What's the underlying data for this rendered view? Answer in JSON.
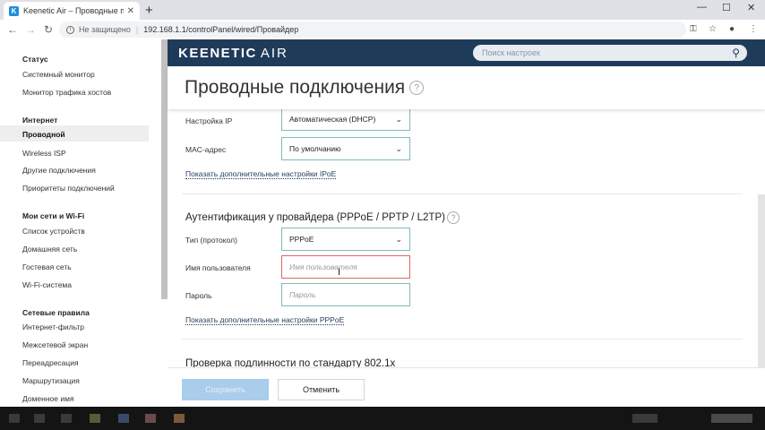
{
  "browser": {
    "tab_title": "Keenetic Air – Проводные подк",
    "favicon_letter": "K",
    "close_glyph": "✕",
    "new_tab_glyph": "+",
    "win_minimize": "—",
    "win_maximize": "☐",
    "win_close": "✕",
    "back": "←",
    "forward": "→",
    "reload": "↻",
    "info_glyph": "i",
    "security_label": "Не защищено",
    "separator": "|",
    "url": "192.168.1.1/controlPanel/wired/Провайдер",
    "key_glyph": "⚿",
    "star_glyph": "☆",
    "account_glyph": "●",
    "menu_glyph": "⋮"
  },
  "header": {
    "logo_main": "KEENETIC",
    "logo_suffix": "AIR",
    "search_placeholder": "Поиск настроек",
    "search_icon": "⚲"
  },
  "sidebar": {
    "groups": [
      {
        "title": "Статус",
        "items": [
          "Системный монитор",
          "Монитор трафика хостов"
        ]
      },
      {
        "title": "Интернет",
        "items": [
          "Проводной",
          "Wireless ISP",
          "Другие подключения",
          "Приоритеты подключений"
        ]
      },
      {
        "title": "Мои сети и Wi-Fi",
        "items": [
          "Список устройств",
          "Домашняя сеть",
          "Гостевая сеть",
          "Wi-Fi-система"
        ]
      },
      {
        "title": "Сетевые правила",
        "items": [
          "Интернет-фильтр",
          "Межсетевой экран",
          "Переадресация",
          "Маршрутизация",
          "Доменное имя"
        ]
      }
    ],
    "active_item": "Проводной"
  },
  "main": {
    "page_title": "Проводные подключения",
    "help_glyph": "?",
    "ip_settings_label": "Настройка IP",
    "ip_settings_value": "Автоматическая (DHCP)",
    "mac_label": "MAC-адрес",
    "mac_value": "По умолчанию",
    "ipoe_link": "Показать дополнительные настройки IPoE",
    "auth_section_title": "Аутентификация у провайдера (PPPoE / PPTP / L2TP)",
    "type_label": "Тип (протокол)",
    "type_value": "PPPoE",
    "username_label": "Имя пользователя",
    "username_placeholder": "Имя пользователя",
    "password_label": "Пароль",
    "password_placeholder": "Пароль",
    "pppoe_link": "Показать дополнительные настройки PPPoE",
    "dot1x_section_title": "Проверка подлинности по стандарту 802.1x",
    "chevron": "⌄",
    "text_cursor": "I"
  },
  "footer": {
    "save_label": "Сохранить",
    "cancel_label": "Отменить"
  }
}
